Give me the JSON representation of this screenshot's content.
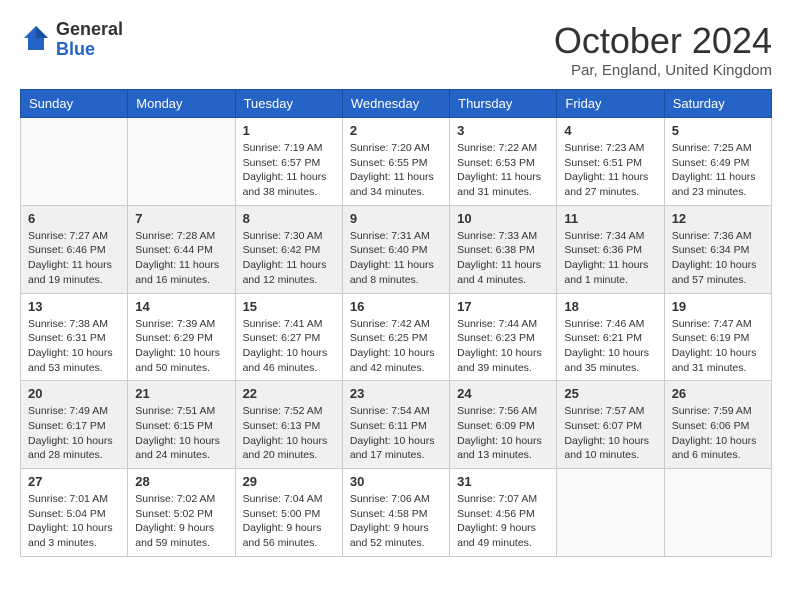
{
  "header": {
    "logo": {
      "general": "General",
      "blue": "Blue"
    },
    "title": "October 2024",
    "location": "Par, England, United Kingdom"
  },
  "days_of_week": [
    "Sunday",
    "Monday",
    "Tuesday",
    "Wednesday",
    "Thursday",
    "Friday",
    "Saturday"
  ],
  "weeks": [
    [
      {
        "day": "",
        "sunrise": "",
        "sunset": "",
        "daylight": ""
      },
      {
        "day": "",
        "sunrise": "",
        "sunset": "",
        "daylight": ""
      },
      {
        "day": "1",
        "sunrise": "Sunrise: 7:19 AM",
        "sunset": "Sunset: 6:57 PM",
        "daylight": "Daylight: 11 hours and 38 minutes."
      },
      {
        "day": "2",
        "sunrise": "Sunrise: 7:20 AM",
        "sunset": "Sunset: 6:55 PM",
        "daylight": "Daylight: 11 hours and 34 minutes."
      },
      {
        "day": "3",
        "sunrise": "Sunrise: 7:22 AM",
        "sunset": "Sunset: 6:53 PM",
        "daylight": "Daylight: 11 hours and 31 minutes."
      },
      {
        "day": "4",
        "sunrise": "Sunrise: 7:23 AM",
        "sunset": "Sunset: 6:51 PM",
        "daylight": "Daylight: 11 hours and 27 minutes."
      },
      {
        "day": "5",
        "sunrise": "Sunrise: 7:25 AM",
        "sunset": "Sunset: 6:49 PM",
        "daylight": "Daylight: 11 hours and 23 minutes."
      }
    ],
    [
      {
        "day": "6",
        "sunrise": "Sunrise: 7:27 AM",
        "sunset": "Sunset: 6:46 PM",
        "daylight": "Daylight: 11 hours and 19 minutes."
      },
      {
        "day": "7",
        "sunrise": "Sunrise: 7:28 AM",
        "sunset": "Sunset: 6:44 PM",
        "daylight": "Daylight: 11 hours and 16 minutes."
      },
      {
        "day": "8",
        "sunrise": "Sunrise: 7:30 AM",
        "sunset": "Sunset: 6:42 PM",
        "daylight": "Daylight: 11 hours and 12 minutes."
      },
      {
        "day": "9",
        "sunrise": "Sunrise: 7:31 AM",
        "sunset": "Sunset: 6:40 PM",
        "daylight": "Daylight: 11 hours and 8 minutes."
      },
      {
        "day": "10",
        "sunrise": "Sunrise: 7:33 AM",
        "sunset": "Sunset: 6:38 PM",
        "daylight": "Daylight: 11 hours and 4 minutes."
      },
      {
        "day": "11",
        "sunrise": "Sunrise: 7:34 AM",
        "sunset": "Sunset: 6:36 PM",
        "daylight": "Daylight: 11 hours and 1 minute."
      },
      {
        "day": "12",
        "sunrise": "Sunrise: 7:36 AM",
        "sunset": "Sunset: 6:34 PM",
        "daylight": "Daylight: 10 hours and 57 minutes."
      }
    ],
    [
      {
        "day": "13",
        "sunrise": "Sunrise: 7:38 AM",
        "sunset": "Sunset: 6:31 PM",
        "daylight": "Daylight: 10 hours and 53 minutes."
      },
      {
        "day": "14",
        "sunrise": "Sunrise: 7:39 AM",
        "sunset": "Sunset: 6:29 PM",
        "daylight": "Daylight: 10 hours and 50 minutes."
      },
      {
        "day": "15",
        "sunrise": "Sunrise: 7:41 AM",
        "sunset": "Sunset: 6:27 PM",
        "daylight": "Daylight: 10 hours and 46 minutes."
      },
      {
        "day": "16",
        "sunrise": "Sunrise: 7:42 AM",
        "sunset": "Sunset: 6:25 PM",
        "daylight": "Daylight: 10 hours and 42 minutes."
      },
      {
        "day": "17",
        "sunrise": "Sunrise: 7:44 AM",
        "sunset": "Sunset: 6:23 PM",
        "daylight": "Daylight: 10 hours and 39 minutes."
      },
      {
        "day": "18",
        "sunrise": "Sunrise: 7:46 AM",
        "sunset": "Sunset: 6:21 PM",
        "daylight": "Daylight: 10 hours and 35 minutes."
      },
      {
        "day": "19",
        "sunrise": "Sunrise: 7:47 AM",
        "sunset": "Sunset: 6:19 PM",
        "daylight": "Daylight: 10 hours and 31 minutes."
      }
    ],
    [
      {
        "day": "20",
        "sunrise": "Sunrise: 7:49 AM",
        "sunset": "Sunset: 6:17 PM",
        "daylight": "Daylight: 10 hours and 28 minutes."
      },
      {
        "day": "21",
        "sunrise": "Sunrise: 7:51 AM",
        "sunset": "Sunset: 6:15 PM",
        "daylight": "Daylight: 10 hours and 24 minutes."
      },
      {
        "day": "22",
        "sunrise": "Sunrise: 7:52 AM",
        "sunset": "Sunset: 6:13 PM",
        "daylight": "Daylight: 10 hours and 20 minutes."
      },
      {
        "day": "23",
        "sunrise": "Sunrise: 7:54 AM",
        "sunset": "Sunset: 6:11 PM",
        "daylight": "Daylight: 10 hours and 17 minutes."
      },
      {
        "day": "24",
        "sunrise": "Sunrise: 7:56 AM",
        "sunset": "Sunset: 6:09 PM",
        "daylight": "Daylight: 10 hours and 13 minutes."
      },
      {
        "day": "25",
        "sunrise": "Sunrise: 7:57 AM",
        "sunset": "Sunset: 6:07 PM",
        "daylight": "Daylight: 10 hours and 10 minutes."
      },
      {
        "day": "26",
        "sunrise": "Sunrise: 7:59 AM",
        "sunset": "Sunset: 6:06 PM",
        "daylight": "Daylight: 10 hours and 6 minutes."
      }
    ],
    [
      {
        "day": "27",
        "sunrise": "Sunrise: 7:01 AM",
        "sunset": "Sunset: 5:04 PM",
        "daylight": "Daylight: 10 hours and 3 minutes."
      },
      {
        "day": "28",
        "sunrise": "Sunrise: 7:02 AM",
        "sunset": "Sunset: 5:02 PM",
        "daylight": "Daylight: 9 hours and 59 minutes."
      },
      {
        "day": "29",
        "sunrise": "Sunrise: 7:04 AM",
        "sunset": "Sunset: 5:00 PM",
        "daylight": "Daylight: 9 hours and 56 minutes."
      },
      {
        "day": "30",
        "sunrise": "Sunrise: 7:06 AM",
        "sunset": "Sunset: 4:58 PM",
        "daylight": "Daylight: 9 hours and 52 minutes."
      },
      {
        "day": "31",
        "sunrise": "Sunrise: 7:07 AM",
        "sunset": "Sunset: 4:56 PM",
        "daylight": "Daylight: 9 hours and 49 minutes."
      },
      {
        "day": "",
        "sunrise": "",
        "sunset": "",
        "daylight": ""
      },
      {
        "day": "",
        "sunrise": "",
        "sunset": "",
        "daylight": ""
      }
    ]
  ]
}
